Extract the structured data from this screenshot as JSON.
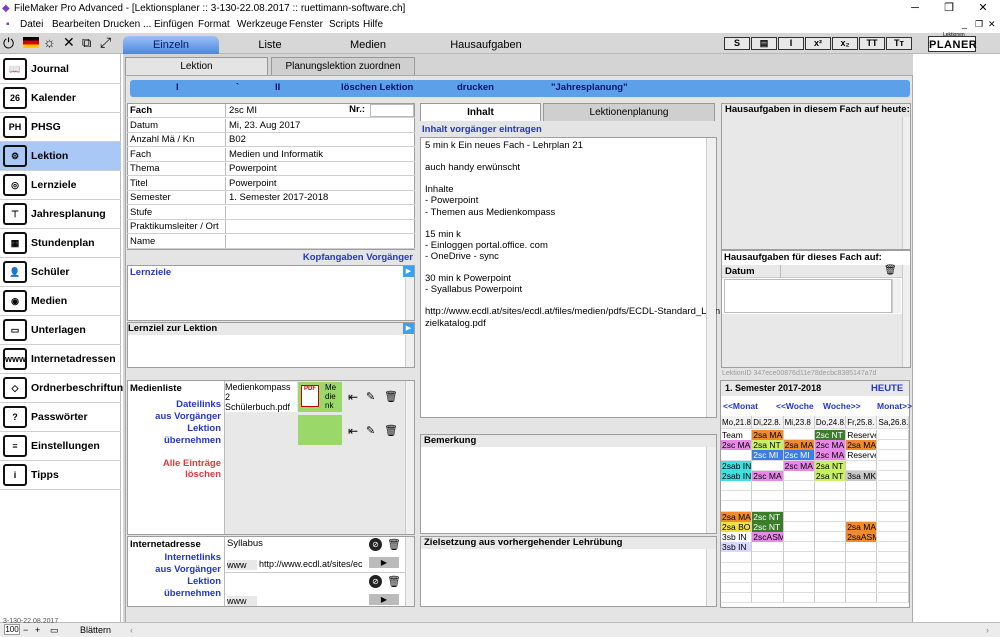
{
  "window": {
    "title": "FileMaker Pro Advanced - [Lektionsplaner :: 3-130-22.08.2017 :: ruettimann-software.ch]",
    "min": "─",
    "max": "❐",
    "close": "✕"
  },
  "menu": [
    "Datei",
    "Bearbeiten",
    "Drucken ...",
    "Einfügen",
    "Format",
    "Werkzeuge",
    "Fenster",
    "Scripts",
    "Hilfe"
  ],
  "tabs": [
    "Einzeln",
    "Liste",
    "Medien",
    "Hausaufgaben"
  ],
  "format_buttons": [
    "S",
    "▤",
    "I",
    "x²",
    "x₂",
    "TT",
    "Tт"
  ],
  "logo": "PLANER",
  "logo_small": "Lektionen",
  "sidebar": [
    {
      "label": "Journal",
      "icon": "book-icon",
      "glyph": "📖"
    },
    {
      "label": "Kalender",
      "icon": "calendar-icon",
      "glyph": "26"
    },
    {
      "label": "PHSG",
      "icon": "phsg-icon",
      "glyph": "PH"
    },
    {
      "label": "Lektion",
      "icon": "lesson-icon",
      "glyph": "⚙"
    },
    {
      "label": "Lernziele",
      "icon": "target-icon",
      "glyph": "◎"
    },
    {
      "label": "Jahresplanung",
      "icon": "hierarchy-icon",
      "glyph": "⊤"
    },
    {
      "label": "Stundenplan",
      "icon": "grid-icon",
      "glyph": "▦"
    },
    {
      "label": "Schüler",
      "icon": "student-icon",
      "glyph": "👤"
    },
    {
      "label": "Medien",
      "icon": "camera-icon",
      "glyph": "◉"
    },
    {
      "label": "Unterlagen",
      "icon": "folder-icon",
      "glyph": "▭"
    },
    {
      "label": "Internetadressen",
      "icon": "globe-icon",
      "glyph": "www"
    },
    {
      "label": "Ordnerbeschriftung",
      "icon": "tag-icon",
      "glyph": "◇"
    },
    {
      "label": "Passwörter",
      "icon": "lock-icon",
      "glyph": "?"
    },
    {
      "label": "Einstellungen",
      "icon": "sliders-icon",
      "glyph": "≡"
    },
    {
      "label": "Tipps",
      "icon": "tip-icon",
      "glyph": "i"
    }
  ],
  "subtabs": [
    "Lektion",
    "Planungslektion zuordnen"
  ],
  "bluebar": [
    "I",
    "`",
    "II",
    "löschen Lektion",
    "drucken",
    "\"Jahresplanung\""
  ],
  "fields": [
    {
      "label": "Fach",
      "value": "2sc MI"
    },
    {
      "label": "Datum",
      "value": "Mi, 23. Aug 2017"
    },
    {
      "label": "Anzahl Mä / Kn",
      "value": "B02"
    },
    {
      "label": "Fach",
      "value": "Medien und Informatik"
    },
    {
      "label": "Thema",
      "value": "Powerpoint"
    },
    {
      "label": "Titel",
      "value": "Powerpoint"
    },
    {
      "label": "Semester",
      "value": "1. Semester 2017-2018"
    },
    {
      "label": "Stufe",
      "value": ""
    },
    {
      "label": "Praktikumsleiter / Ort",
      "value": ""
    },
    {
      "label": "Name",
      "value": ""
    }
  ],
  "nr_label": "Nr.:",
  "kopfangaben": "Kopfangaben Vorgänger",
  "lernziele": "Lernziele",
  "lernziel_lektion": "Lernziel zur Lektion",
  "medienliste": {
    "label": "Medienliste",
    "dateilinks": "Dateilinks\naus Vorgänger\nLektion übernehmen",
    "delete_all": "Alle Einträge löschen",
    "item_name": "Medienkompass 2 Schülerbuch.pdf",
    "pdf_label": "Me die nk",
    "pdf_badge": "PDF"
  },
  "internet": {
    "label": "Internetadresse",
    "links": "Internetlinks\naus Vorgänger\nLektion übernehmen",
    "entry1_title": "Syllabus",
    "www": "www",
    "url1": "http://www.ecdl.at/sites/ec",
    "url2": ""
  },
  "center_tabs": [
    "Inhalt",
    "Lektionenplanung"
  ],
  "inhalt_vorgaenger": "Inhalt vorgänger eintragen",
  "inhalt_lines": [
    "5 min k Ein neues Fach - Lehrplan 21",
    "",
    "auch handy erwünscht",
    "",
    "Inhalte",
    "- Powerpoint",
    "- Themen aus Medienkompass",
    "",
    "15 min k",
    "- Einloggen portal.office. com",
    "- OneDrive - sync",
    "",
    "30 min k Powerpoint",
    "- Syallabus Powerpoint",
    "",
    "http://www.ecdl.at/sites/ecdl.at/files/medien/pdfs/ECDL-Standard_Lern",
    "zielkatalog.pdf"
  ],
  "bemerkung": "Bemerkung",
  "zielsetzung": "Zielsetzung aus vorhergehender Lehrübung",
  "hausaufgaben_heute": "Hausaufgaben in diesem Fach auf heute:",
  "hausaufgaben_auf": "Hausaufgaben für dieses Fach auf:",
  "datum_col": "Datum",
  "lektion_id": "LektionID 347ece00876d11e78decbc8385147a7d",
  "calendar": {
    "semester": "1. Semester 2017-2018",
    "heute": "HEUTE",
    "nav": [
      "<<Monat",
      "<<Woche",
      "Woche>>",
      "Monat>>"
    ],
    "days": [
      "Mo,21.8",
      "Di,22.8.",
      "Mi,23.8",
      "Do,24.8.",
      "Fr,25.8.",
      "Sa,26.8."
    ],
    "cells": [
      {
        "c": 0,
        "r": 0,
        "t": "Team",
        "bg": "#ffffff"
      },
      {
        "c": 1,
        "r": 0,
        "t": "2sa MA",
        "bg": "#f08a2a"
      },
      {
        "c": 3,
        "r": 0,
        "t": "2sc NT",
        "bg": "#3a7d2a"
      },
      {
        "c": 4,
        "r": 0,
        "t": "Reserve",
        "bg": "#ffffff"
      },
      {
        "c": 0,
        "r": 1,
        "t": "2sc MA",
        "bg": "#e889e8"
      },
      {
        "c": 1,
        "r": 1,
        "t": "2sa NT",
        "bg": "#c8f060"
      },
      {
        "c": 2,
        "r": 1,
        "t": "2sa MA",
        "bg": "#f08a2a"
      },
      {
        "c": 3,
        "r": 1,
        "t": "2sc MA",
        "bg": "#e889e8"
      },
      {
        "c": 4,
        "r": 1,
        "t": "2sa MA",
        "bg": "#f08a2a"
      },
      {
        "c": 1,
        "r": 2,
        "t": "2sc MI",
        "bg": "#3b7de8"
      },
      {
        "c": 2,
        "r": 2,
        "t": "2sc MI",
        "bg": "#3b7de8"
      },
      {
        "c": 3,
        "r": 2,
        "t": "2sc MA",
        "bg": "#e889e8"
      },
      {
        "c": 4,
        "r": 2,
        "t": "Reserve",
        "bg": "#ffffff"
      },
      {
        "c": 0,
        "r": 3,
        "t": "2sab IN",
        "bg": "#40e0e0"
      },
      {
        "c": 2,
        "r": 3,
        "t": "2sc MA",
        "bg": "#e889e8"
      },
      {
        "c": 3,
        "r": 3,
        "t": "2sa NT",
        "bg": "#c8f060"
      },
      {
        "c": 0,
        "r": 4,
        "t": "2sab IN",
        "bg": "#40e0e0"
      },
      {
        "c": 1,
        "r": 4,
        "t": "2sc MA",
        "bg": "#e889e8"
      },
      {
        "c": 3,
        "r": 4,
        "t": "2sa NT",
        "bg": "#c8f060"
      },
      {
        "c": 4,
        "r": 4,
        "t": "3sa MK",
        "bg": "#c8c8c8"
      },
      {
        "c": 0,
        "r": 8,
        "t": "2sa MA",
        "bg": "#f08a2a"
      },
      {
        "c": 1,
        "r": 8,
        "t": "2sc NT",
        "bg": "#3a7d2a"
      },
      {
        "c": 0,
        "r": 9,
        "t": "2sa BO",
        "bg": "#f0e040"
      },
      {
        "c": 1,
        "r": 9,
        "t": "2sc NT",
        "bg": "#3a7d2a"
      },
      {
        "c": 4,
        "r": 9,
        "t": "2sa MA",
        "bg": "#f08a2a"
      },
      {
        "c": 0,
        "r": 10,
        "t": "3sb IN",
        "bg": "#ffffff"
      },
      {
        "c": 1,
        "r": 10,
        "t": "2scASM",
        "bg": "#e889e8"
      },
      {
        "c": 4,
        "r": 10,
        "t": "2saASM",
        "bg": "#f08a2a"
      },
      {
        "c": 0,
        "r": 11,
        "t": "3sb IN",
        "bg": "#d8d8ff"
      }
    ]
  },
  "status": {
    "record": "3-130-22.08.2017",
    "zoom": "100",
    "mode": "Blättern"
  }
}
